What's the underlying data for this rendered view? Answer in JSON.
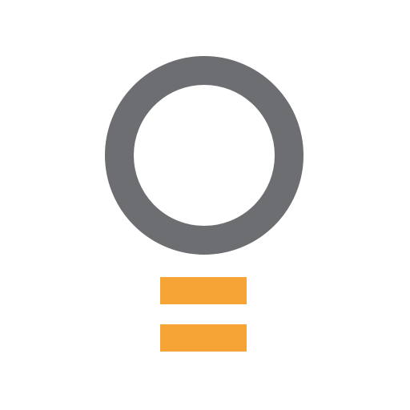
{
  "logo": {
    "name": "lightbulb-logo",
    "colors": {
      "background": "#ffffff",
      "ring": "#6d6e71",
      "bars": "#f6a436"
    }
  }
}
